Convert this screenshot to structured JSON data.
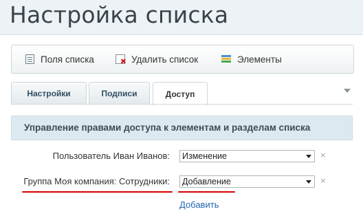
{
  "page": {
    "title": "Настройка списка"
  },
  "toolbar": {
    "items": [
      {
        "label": "Поля списка",
        "icon": "list-fields-icon"
      },
      {
        "label": "Удалить список",
        "icon": "delete-list-icon"
      },
      {
        "label": "Элементы",
        "icon": "elements-icon"
      }
    ]
  },
  "tabs": [
    {
      "label": "Настройки",
      "active": false
    },
    {
      "label": "Подписи",
      "active": false
    },
    {
      "label": "Доступ",
      "active": true
    }
  ],
  "access": {
    "header": "Управление правами доступа к элементам и разделам списка",
    "rows": [
      {
        "subject": "Пользователь Иван Иванов:",
        "permission": "Изменение"
      },
      {
        "subject": "Группа Моя компания: Сотрудники:",
        "permission": "Добавление"
      }
    ],
    "add_label": "Добавить",
    "delete_symbol": "×"
  },
  "colors": {
    "accent_underline": "#d40000",
    "link": "#2067b0",
    "section_bg": "#dde9f0"
  }
}
